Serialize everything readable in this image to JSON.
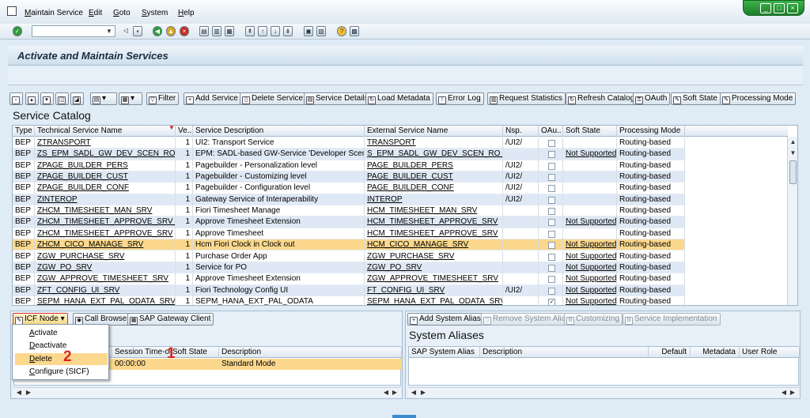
{
  "menu": {
    "items": [
      "Maintain Service",
      "Edit",
      "Goto",
      "System",
      "Help"
    ]
  },
  "window_controls": {
    "minimize": "_",
    "maximize": "□",
    "close": "×"
  },
  "command_field": {
    "value": ""
  },
  "page_title": "Activate and Maintain Services",
  "toolbar": {
    "filter": "Filter",
    "add_service": "Add Service",
    "delete_service": "Delete Service",
    "service_details": "Service Details",
    "load_metadata": "Load Metadata",
    "error_log": "Error Log",
    "request_statistics": "Request Statistics",
    "refresh_catalog": "Refresh Catalog",
    "oauth": "OAuth",
    "soft_state": "Soft State",
    "processing_mode": "Processing Mode"
  },
  "catalog": {
    "title": "Service Catalog",
    "columns": [
      "Type",
      "Technical Service Name",
      "Ve..",
      "Service Description",
      "External Service Name",
      "Nsp.",
      "OAu..",
      "Soft State",
      "Processing Mode"
    ],
    "rows": [
      [
        "BEP",
        "ZTRANSPORT",
        "1",
        "UI2: Transport Service",
        "TRANSPORT",
        "/UI2/",
        "",
        "",
        "Routing-based"
      ],
      [
        "BEP",
        "ZS_EPM_SADL_GW_DEV_SCEN_RO_S...",
        "1",
        "EPM: SADL-based GW-Service 'Developer Scenari...",
        "S_EPM_SADL_GW_DEV_SCEN_RO_SRV",
        "",
        "",
        "Not Supported",
        "Routing-based"
      ],
      [
        "BEP",
        "ZPAGE_BUILDER_PERS",
        "1",
        "Pagebuilder - Personalization level",
        "PAGE_BUILDER_PERS",
        "/UI2/",
        "",
        "",
        "Routing-based"
      ],
      [
        "BEP",
        "ZPAGE_BUILDER_CUST",
        "1",
        "Pagebuilder - Customizing level",
        "PAGE_BUILDER_CUST",
        "/UI2/",
        "",
        "",
        "Routing-based"
      ],
      [
        "BEP",
        "ZPAGE_BUILDER_CONF",
        "1",
        "Pagebuilder - Configuration level",
        "PAGE_BUILDER_CONF",
        "/UI2/",
        "",
        "",
        "Routing-based"
      ],
      [
        "BEP",
        "ZINTEROP",
        "1",
        "Gateway Service of Interaperability",
        "INTEROP",
        "/UI2/",
        "",
        "",
        "Routing-based"
      ],
      [
        "BEP",
        "ZHCM_TIMESHEET_MAN_SRV",
        "1",
        "Fiori Timesheet Manage",
        "HCM_TIMESHEET_MAN_SRV",
        "",
        "",
        "",
        "Routing-based"
      ],
      [
        "BEP",
        "ZHCM_TIMESHEET_APPROVE_SRV_1",
        "1",
        "Approve Timesheet Extension",
        "HCM_TIMESHEET_APPROVE_SRV",
        "",
        "",
        "Not Supported",
        "Routing-based"
      ],
      [
        "BEP",
        "ZHCM_TIMESHEET_APPROVE_SRV",
        "1",
        "Approve Timesheet",
        "HCM_TIMESHEET_APPROVE_SRV",
        "",
        "",
        "",
        "Routing-based"
      ],
      [
        "BEP",
        "ZHCM_CICO_MANAGE_SRV",
        "1",
        "Hcm Fiori Clock in Clock out",
        "HCM_CICO_MANAGE_SRV",
        "",
        "",
        "Not Supported",
        "Routing-based"
      ],
      [
        "BEP",
        "ZGW_PURCHASE_SRV",
        "1",
        "Purchase Order App",
        "ZGW_PURCHASE_SRV",
        "",
        "",
        "Not Supported",
        "Routing-based"
      ],
      [
        "BEP",
        "ZGW_PO_SRV",
        "1",
        "Service for PO",
        "ZGW_PO_SRV",
        "",
        "",
        "Not Supported",
        "Routing-based"
      ],
      [
        "BEP",
        "ZGW_APPROVE_TIMESHEET_SRV",
        "1",
        "Approve Timesheet Extension",
        "ZGW_APPROVE_TIMESHEET_SRV",
        "",
        "",
        "Not Supported",
        "Routing-based"
      ],
      [
        "BEP",
        "ZFT_CONFIG_UI_SRV",
        "1",
        "Fiori Technology Config UI",
        "FT_CONFIG_UI_SRV",
        "/UI2/",
        "",
        "Not Supported",
        "Routing-based"
      ],
      [
        "BEP",
        "SEPM_HANA_EXT_PAL_ODATA_SRV",
        "1",
        "SEPM_HANA_EXT_PAL_ODATA",
        "SEPM_HANA_EXT_PAL_ODATA_SRV",
        "",
        "✓",
        "Not Supported",
        "Routing-based"
      ]
    ]
  },
  "icf": {
    "icf_node": "ICF Node",
    "call_browser": "Call Browser",
    "gateway_client": "SAP Gateway Client",
    "columns": [
      "Session Time-out",
      "Soft State",
      "Description"
    ],
    "row": [
      "00:00:00",
      "",
      "Standard Mode"
    ],
    "menu": [
      "Activate",
      "Deactivate",
      "Delete",
      "Configure (SICF)"
    ]
  },
  "markers": {
    "one": "1",
    "two": "2"
  },
  "aliases": {
    "title": "System Aliases",
    "add": "Add System Alias",
    "remove": "Remove System Alias",
    "customizing": "Customizing",
    "service_impl": "Service Implementation",
    "columns": [
      "SAP System Alias",
      "Description",
      "Default",
      "Metadata",
      "User Role"
    ]
  }
}
